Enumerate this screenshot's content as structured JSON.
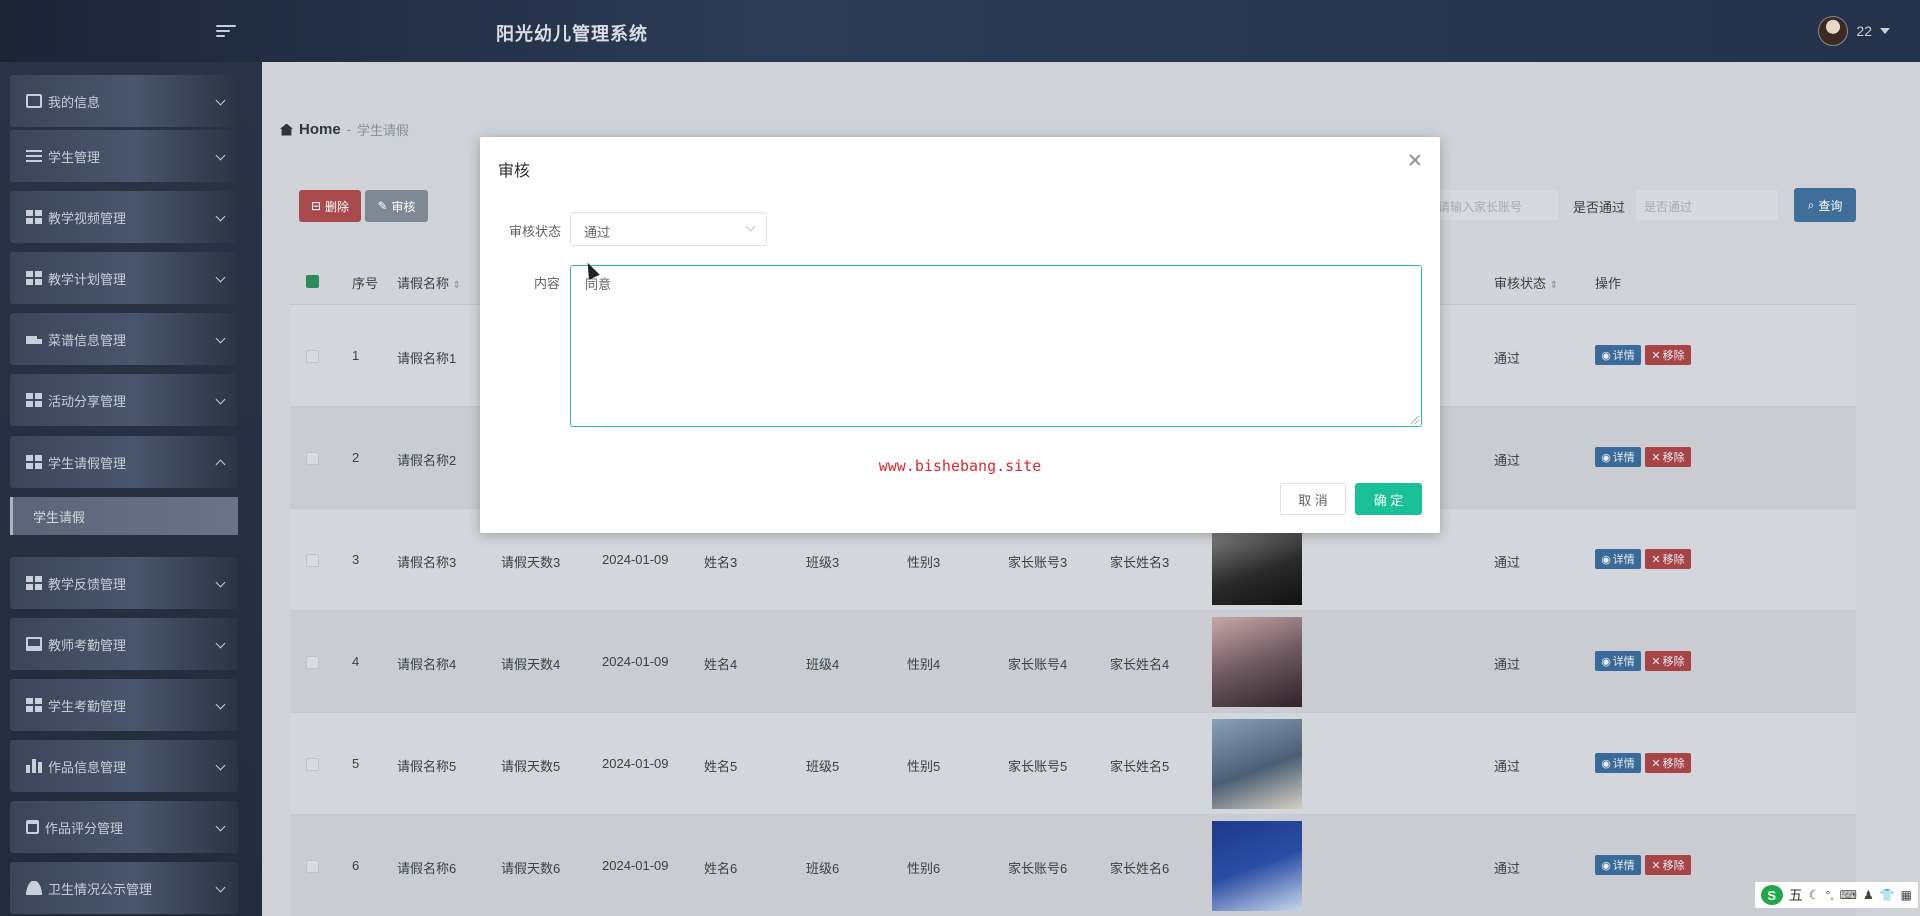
{
  "app": {
    "title": "阳光幼儿管理系统",
    "username": "22"
  },
  "sidebar": {
    "items": [
      {
        "label": "我的信息",
        "icon": "card-icon"
      },
      {
        "label": "学生管理",
        "icon": "list-icon"
      },
      {
        "label": "教学视频管理",
        "icon": "grid-icon"
      },
      {
        "label": "教学计划管理",
        "icon": "grid-icon"
      },
      {
        "label": "菜谱信息管理",
        "icon": "truck-icon"
      },
      {
        "label": "活动分享管理",
        "icon": "grid-icon"
      },
      {
        "label": "学生请假管理",
        "icon": "grid-icon"
      },
      {
        "label": "教学反馈管理",
        "icon": "grid-icon"
      },
      {
        "label": "教师考勤管理",
        "icon": "monitor-icon"
      },
      {
        "label": "学生考勤管理",
        "icon": "grid-icon"
      },
      {
        "label": "作品信息管理",
        "icon": "bar-icon"
      },
      {
        "label": "作品评分管理",
        "icon": "clip-icon"
      },
      {
        "label": "卫生情况公示管理",
        "icon": "person-icon"
      }
    ],
    "sub_item": "学生请假"
  },
  "breadcrumb": {
    "home": "Home",
    "sep": "-",
    "page": "学生请假"
  },
  "toolbar": {
    "delete_label": "删除",
    "audit_label": "审核",
    "filter_placeholder": "请输入家长账号",
    "pass_label": "是否通过",
    "pass_placeholder": "是否通过",
    "query_label": "查询"
  },
  "table": {
    "headers": [
      "序号",
      "请假名称",
      "审核状态",
      "操作"
    ],
    "rows": [
      {
        "no": "1",
        "name": "请假名称1",
        "status": "通过"
      },
      {
        "no": "2",
        "name": "请假名称2",
        "status": "通过"
      },
      {
        "no": "3",
        "name": "请假名称3",
        "days": "请假天数3",
        "date": "2024-01-09",
        "student": "姓名3",
        "class": "班级3",
        "gender": "性别3",
        "parent_acct": "家长账号3",
        "parent_name": "家长姓名3",
        "status": "通过"
      },
      {
        "no": "4",
        "name": "请假名称4",
        "days": "请假天数4",
        "date": "2024-01-09",
        "student": "姓名4",
        "class": "班级4",
        "gender": "性别4",
        "parent_acct": "家长账号4",
        "parent_name": "家长姓名4",
        "status": "通过"
      },
      {
        "no": "5",
        "name": "请假名称5",
        "days": "请假天数5",
        "date": "2024-01-09",
        "student": "姓名5",
        "class": "班级5",
        "gender": "性别5",
        "parent_acct": "家长账号5",
        "parent_name": "家长姓名5",
        "status": "通过"
      },
      {
        "no": "6",
        "name": "请假名称6",
        "days": "请假天数6",
        "date": "2024-01-09",
        "student": "姓名6",
        "class": "班级6",
        "gender": "性别6",
        "parent_acct": "家长账号6",
        "parent_name": "家长姓名6",
        "status": "通过"
      }
    ],
    "detail_label": "详情",
    "remove_label": "移除"
  },
  "modal": {
    "title": "审核",
    "status_label": "审核状态",
    "status_value": "通过",
    "content_label": "内容",
    "content_value": "同意",
    "watermark": "www.bishebang.site",
    "cancel_label": "取 消",
    "ok_label": "确 定"
  },
  "ime": {
    "mode": "五"
  },
  "colors": {
    "ok": "#18c196",
    "danger": "#a84a4c",
    "primary": "#3f6e9b",
    "watermark": "#e0262b"
  }
}
